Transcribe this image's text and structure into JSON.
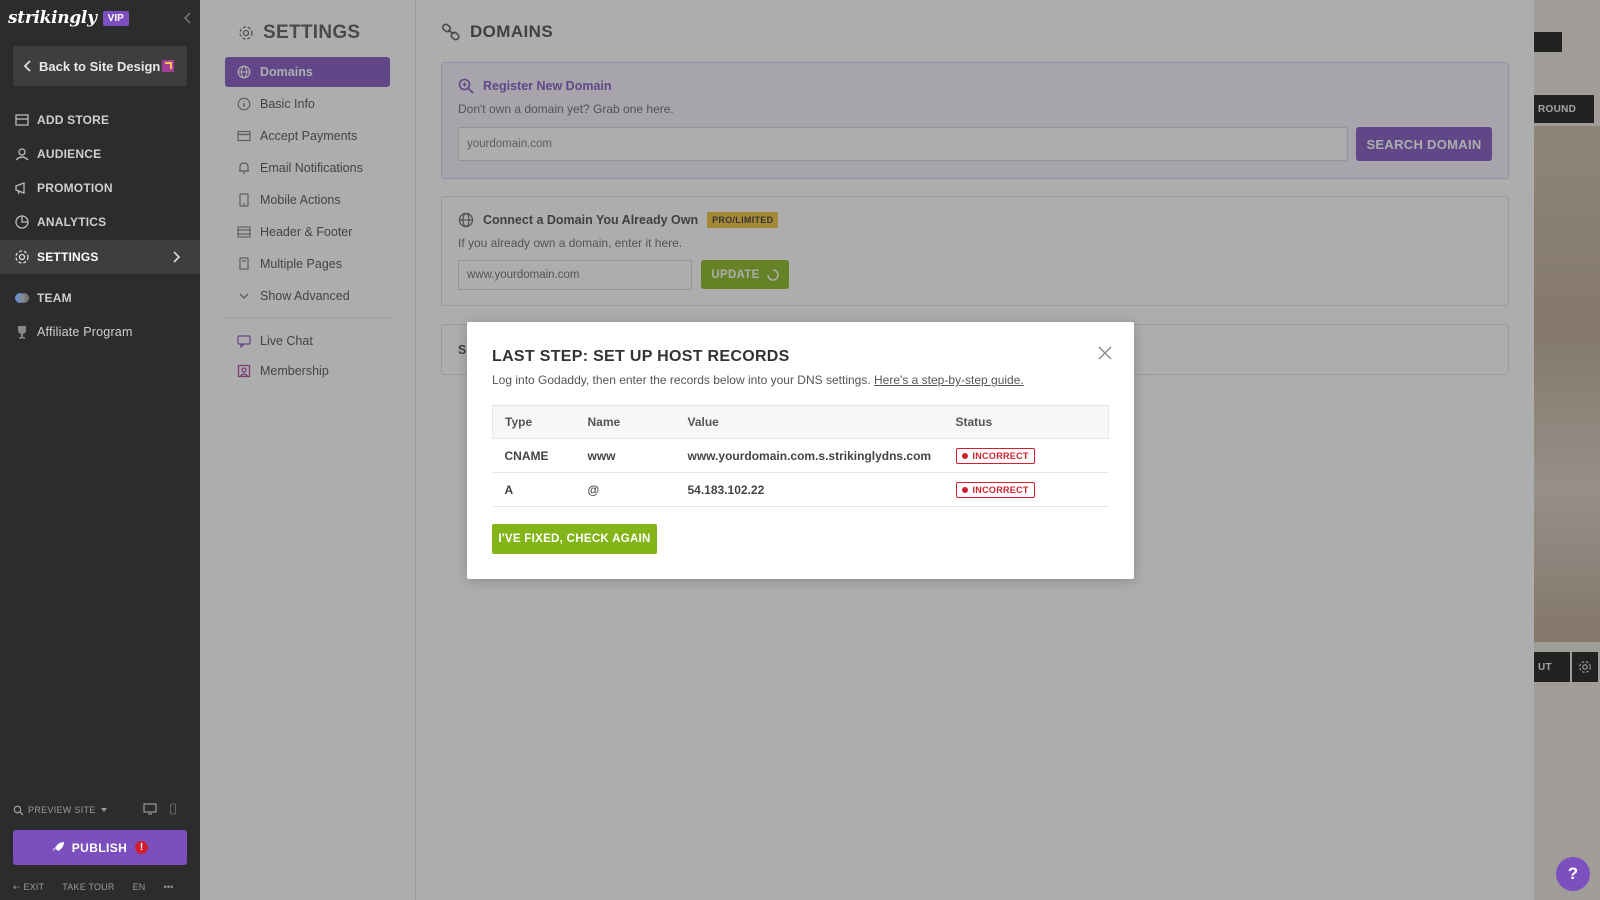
{
  "app": {
    "logo": "strikingly",
    "vip": "VIP"
  },
  "sidebar": {
    "back_label": "Back to Site Design",
    "items": [
      {
        "label": "ADD STORE",
        "icon": "store-icon"
      },
      {
        "label": "AUDIENCE",
        "icon": "audience-icon"
      },
      {
        "label": "PROMOTION",
        "icon": "megaphone-icon"
      },
      {
        "label": "ANALYTICS",
        "icon": "chart-icon"
      },
      {
        "label": "SETTINGS",
        "icon": "gear-icon"
      },
      {
        "label": "TEAM",
        "icon": "team-icon"
      },
      {
        "label": "Affiliate Program",
        "icon": "trophy-icon"
      }
    ],
    "preview_label": "PREVIEW SITE",
    "publish_label": "PUBLISH",
    "publish_alert": "!",
    "footer": {
      "exit": "EXIT",
      "tour": "TAKE TOUR",
      "lang": "EN",
      "more": "•••"
    }
  },
  "settings": {
    "title": "SETTINGS",
    "nav": [
      {
        "label": "Domains"
      },
      {
        "label": "Basic Info"
      },
      {
        "label": "Accept Payments"
      },
      {
        "label": "Email Notifications"
      },
      {
        "label": "Mobile Actions"
      },
      {
        "label": "Header & Footer"
      },
      {
        "label": "Multiple Pages"
      },
      {
        "label": "Show Advanced"
      },
      {
        "label": "Live Chat"
      },
      {
        "label": "Membership"
      }
    ]
  },
  "domains": {
    "title": "DOMAINS",
    "register": {
      "heading": "Register New Domain",
      "sub": "Don't own a domain yet? Grab one here.",
      "placeholder": "yourdomain.com",
      "button": "SEARCH DOMAIN"
    },
    "connect": {
      "heading": "Connect a Domain You Already Own",
      "badge": "PRO/LIMITED",
      "sub": "If you already own a domain, enter it here.",
      "value": "www.yourdomain.com",
      "button": "UPDATE"
    },
    "third_card_letter": "S"
  },
  "preview": {
    "top_label": "ROUND",
    "bottom_label": "UT",
    "help": "?"
  },
  "modal": {
    "title": "LAST STEP: SET UP HOST RECORDS",
    "desc": "Log into Godaddy, then enter the records below into your DNS settings.",
    "guide_link": "Here's a step-by-step guide.",
    "columns": [
      "Type",
      "Name",
      "Value",
      "Status"
    ],
    "rows": [
      {
        "type": "CNAME",
        "name": "www",
        "value": "www.yourdomain.com.s.strikinglydns.com",
        "status": "INCORRECT"
      },
      {
        "type": "A",
        "name": "@",
        "value": "54.183.102.22",
        "status": "INCORRECT"
      }
    ],
    "button": "I'VE FIXED, CHECK AGAIN"
  },
  "colors": {
    "accent": "#7c4fbf",
    "green": "#83b518",
    "error": "#d0202f",
    "badge": "#f1c232"
  }
}
